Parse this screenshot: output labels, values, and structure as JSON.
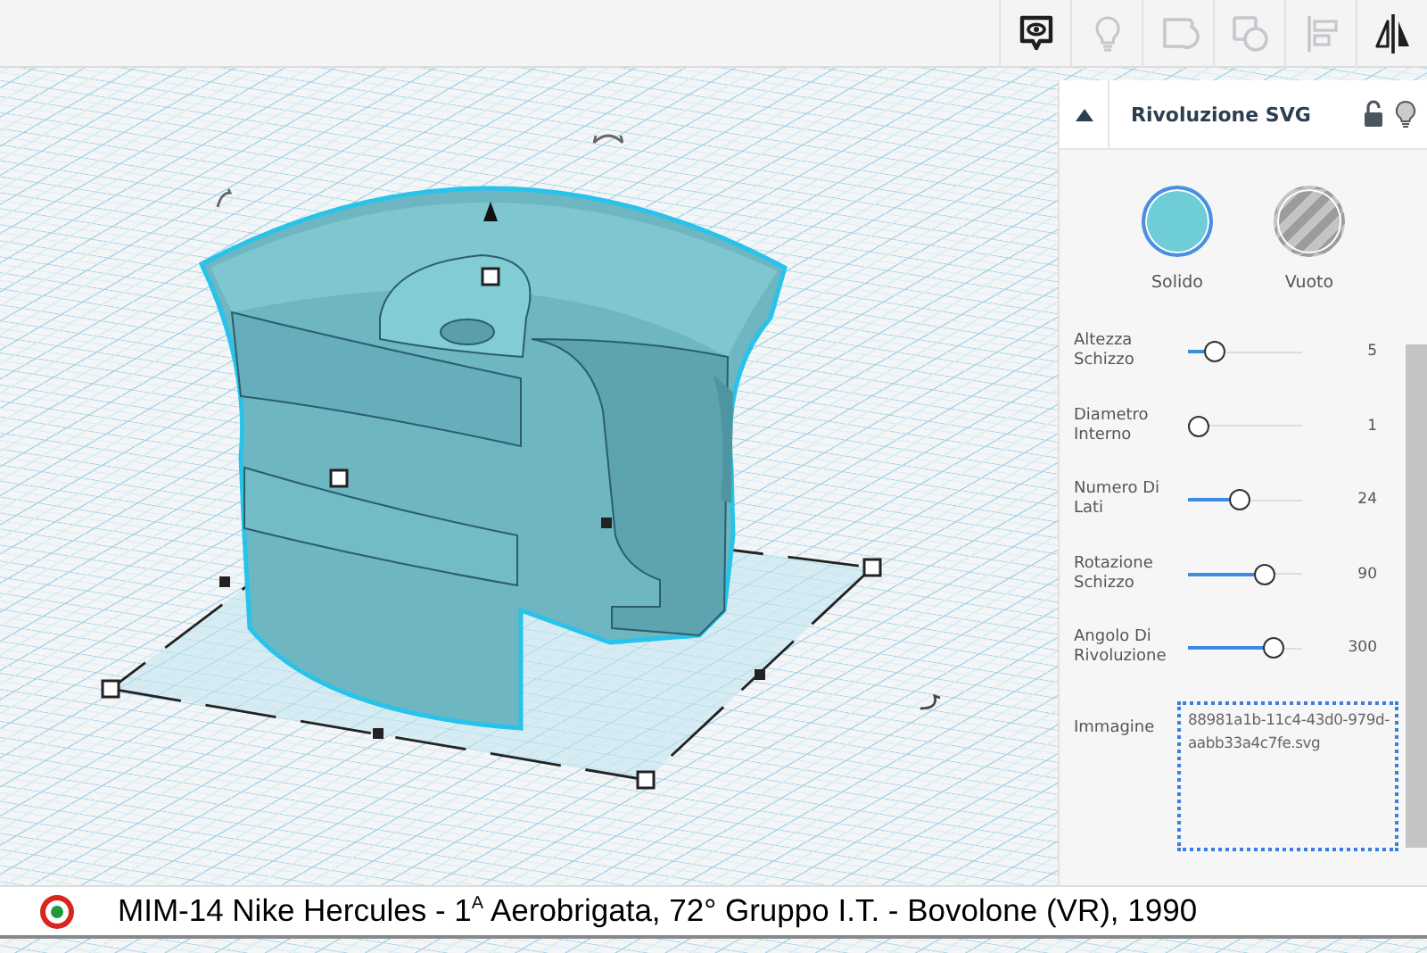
{
  "toolbar": [
    {
      "kind": "notes",
      "disabled": false
    },
    {
      "kind": "light",
      "disabled": true
    },
    {
      "kind": "shape",
      "disabled": true
    },
    {
      "kind": "group",
      "disabled": true
    },
    {
      "kind": "align",
      "disabled": true
    },
    {
      "kind": "mirror",
      "disabled": false
    }
  ],
  "inspector": {
    "title": "Rivoluzione SVG",
    "locked": false,
    "modes": [
      {
        "label": "Solido",
        "kind": "solid",
        "selected": true
      },
      {
        "label": "Vuoto",
        "kind": "hole",
        "selected": false
      }
    ],
    "params": [
      {
        "label": "Altezza Schizzo",
        "level": 0.18,
        "value": "5"
      },
      {
        "label": "Diametro Interno",
        "level": 0,
        "value": "1"
      },
      {
        "label": "Numero Di Lati",
        "level": 0.45,
        "value": "24"
      },
      {
        "label": "Rotazione Schizzo",
        "level": 0.72,
        "value": "90"
      },
      {
        "label": "Angolo Di Rivoluzione",
        "level": 0.8,
        "value": "300"
      }
    ],
    "image": {
      "label": "Immagine",
      "value": "88981a1b-11c4-43d0-979d-aabb33a4c7fe.svg"
    }
  },
  "caption": "MIM-14 Nike Hercules - 1$^{A}$ Aerobrigata, 72° Gruppo I.T. - Bovolone (VR), 1990"
}
